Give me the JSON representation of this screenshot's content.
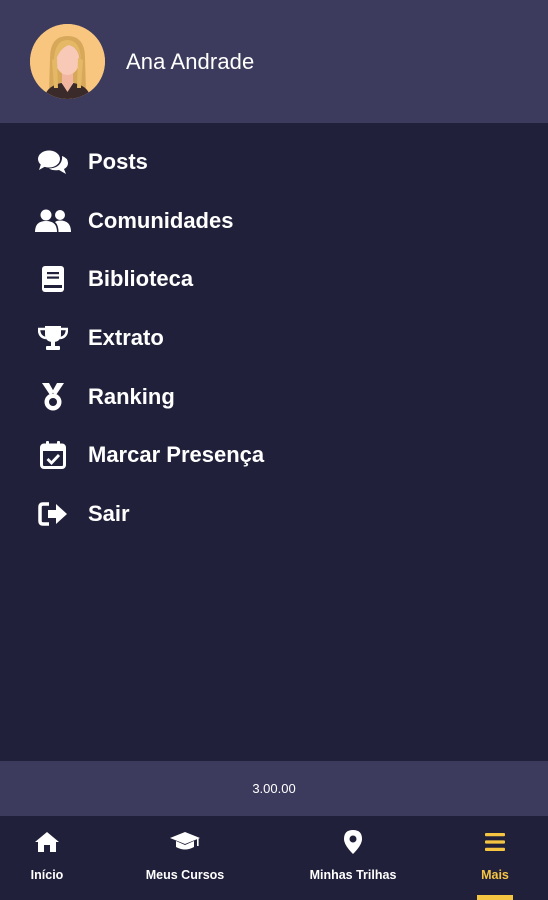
{
  "user": {
    "name": "Ana Andrade"
  },
  "menu": {
    "items": [
      {
        "label": "Posts",
        "icon": "comments-icon"
      },
      {
        "label": "Comunidades",
        "icon": "users-icon"
      },
      {
        "label": "Biblioteca",
        "icon": "book-icon"
      },
      {
        "label": "Extrato",
        "icon": "trophy-icon"
      },
      {
        "label": "Ranking",
        "icon": "medal-icon"
      },
      {
        "label": "Marcar Presença",
        "icon": "calendar-check-icon"
      },
      {
        "label": "Sair",
        "icon": "sign-out-icon"
      }
    ]
  },
  "version": "3.00.00",
  "nav": {
    "items": [
      {
        "label": "Início",
        "icon": "home-icon"
      },
      {
        "label": "Meus Cursos",
        "icon": "graduation-cap-icon"
      },
      {
        "label": "Minhas Trilhas",
        "icon": "map-marker-icon"
      },
      {
        "label": "Mais",
        "icon": "menu-icon",
        "active": true
      }
    ]
  },
  "colors": {
    "background": "#20203a",
    "header": "#3c3b5d",
    "accent": "#f5c542",
    "text": "#ffffff"
  }
}
